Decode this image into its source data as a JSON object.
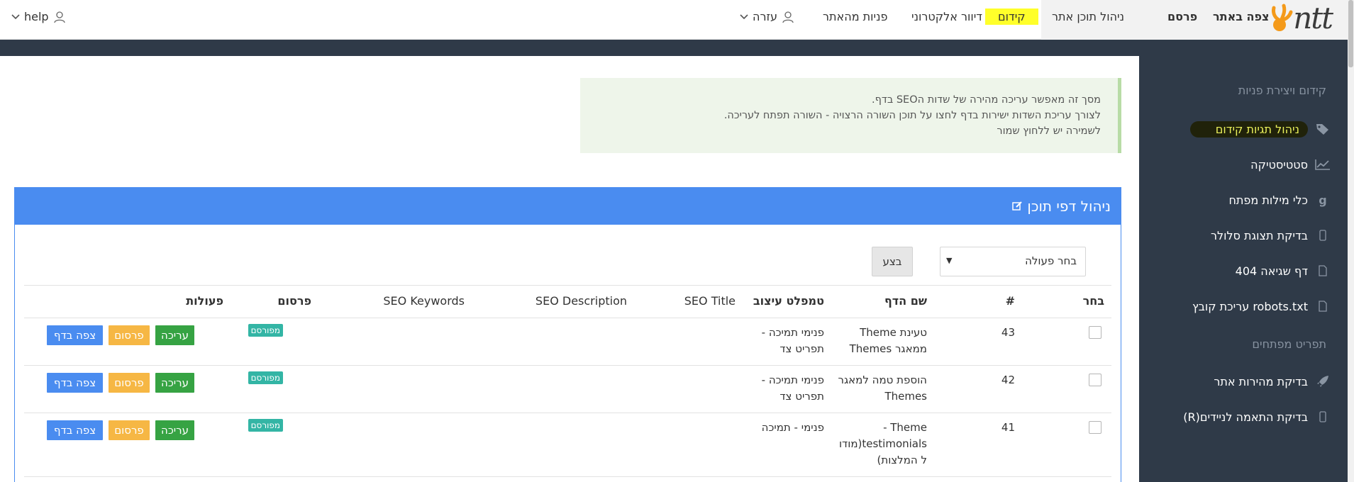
{
  "topbar": {
    "logo_text": "ntt",
    "view_site": "צפה באתר",
    "publish": "פרסם",
    "nav": [
      "ניהול תוכן אתר",
      "קידום",
      "דיוור אלקטרוני",
      "פניות מהאתר"
    ],
    "help_he": "עזרה",
    "help_en": "help"
  },
  "sidebar": {
    "section1": "קידום ויצירת פניות",
    "items1": [
      {
        "label": "ניהול תגיות קידום",
        "icon": "tag-icon"
      },
      {
        "label": "סטטיסטיקה",
        "icon": "chart-line-icon"
      },
      {
        "label": "כלי מילות מפתח",
        "icon": "google-icon"
      },
      {
        "label": "בדיקת תצוגת סלולר",
        "icon": "mobile-icon"
      },
      {
        "label": "דף שגיאה 404",
        "icon": "file-icon"
      },
      {
        "label": "עריכת קובץ robots.txt",
        "icon": "file-icon"
      }
    ],
    "section2": "תפריט מפתחים",
    "items2": [
      {
        "label": "בדיקת מהירות אתר",
        "icon": "rocket-icon"
      },
      {
        "label": "(R)בדיקת התאמה לניידים",
        "icon": "mobile-icon"
      }
    ]
  },
  "alert": {
    "lines": [
      "מסך זה מאפשר עריכה מהירה של שדות הSEO בדף.",
      "לצורך עריכת השדות ישירות בדף לחצו על תוכן השורה הרצויה - השורה תפתח לעריכה.",
      "לשמירה יש ללחוץ שמור"
    ]
  },
  "panel": {
    "title": "ניהול דפי תוכן",
    "select_value": "בחר פעולה",
    "exec_label": "בצע"
  },
  "table": {
    "headers": {
      "select": "בחר",
      "num": "#",
      "page_name": "שם הדף",
      "template": "טמפלט עיצוב",
      "seo_title": "SEO Title",
      "seo_description": "SEO Description",
      "seo_keywords": "SEO Keywords",
      "publish": "פרסום",
      "actions": "פעולות"
    },
    "rows": [
      {
        "id": "43",
        "name_l1": "טעינת Theme",
        "name_l2": "ממאגר Themes",
        "name_l3": "",
        "tpl_l1": "פנימי תמיכה -",
        "tpl_l2": "תפריט צד",
        "status": "מפורסם"
      },
      {
        "id": "42",
        "name_l1": "הוספת טמה למאגר",
        "name_l2": "Themes",
        "name_l3": "",
        "tpl_l1": "פנימי תמיכה -",
        "tpl_l2": "תפריט צד",
        "status": "מפורסם"
      },
      {
        "id": "41",
        "name_l1": "Theme -",
        "name_l2": "testimonials(מודו",
        "name_l3": "ל המלצות)",
        "tpl_l1": "פנימי - תמיכה",
        "tpl_l2": "",
        "status": "מפורסם"
      }
    ],
    "actions": {
      "edit": "עריכה",
      "publish": "פרסום",
      "view": "צפה בדף"
    }
  },
  "colors": {
    "sidebar": "#2f3a48",
    "accent": "#4a8cf0",
    "highlight": "#ffff2a",
    "green": "#36a343",
    "orange": "#f6b744",
    "teal": "#33b5a5"
  }
}
